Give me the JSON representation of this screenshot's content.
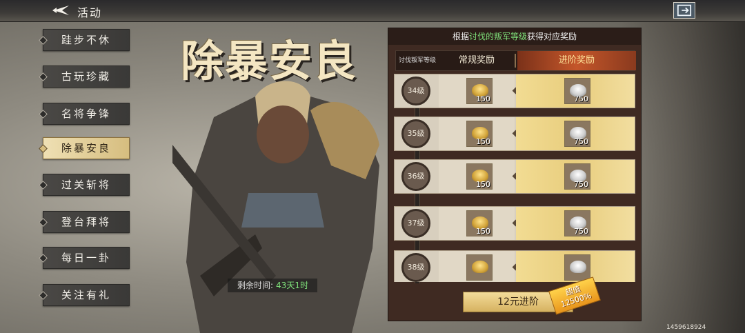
{
  "header": {
    "title": "活动"
  },
  "sidebar": {
    "items": [
      {
        "label": "跬步不休",
        "active": false
      },
      {
        "label": "古玩珍藏",
        "active": false
      },
      {
        "label": "名将争锋",
        "active": false
      },
      {
        "label": "除暴安良",
        "active": true
      },
      {
        "label": "过关斩将",
        "active": false
      },
      {
        "label": "登台拜将",
        "active": false
      },
      {
        "label": "每日一卦",
        "active": false
      },
      {
        "label": "关注有礼",
        "active": false
      }
    ]
  },
  "event": {
    "title": "除暴安良",
    "timer_label": "剩余时间:",
    "timer_value": "43天1时"
  },
  "rewards": {
    "header_pre": "根据",
    "header_highlight": "讨伐的叛军等级",
    "header_post": "获得对应奖励",
    "col_level": "讨伐叛军等级",
    "col_normal": "常规奖励",
    "col_advanced": "进阶奖励",
    "rows": [
      {
        "level": "34级",
        "normal_amount": "150",
        "advanced_amount": "750"
      },
      {
        "level": "35级",
        "normal_amount": "150",
        "advanced_amount": "750"
      },
      {
        "level": "36级",
        "normal_amount": "150",
        "advanced_amount": "750"
      },
      {
        "level": "37级",
        "normal_amount": "150",
        "advanced_amount": "750"
      },
      {
        "level": "38级",
        "normal_amount": "",
        "advanced_amount": ""
      }
    ],
    "buy_label": "12元进阶",
    "promo_line1": "超值",
    "promo_line2": "12500%"
  },
  "footer": {
    "uid": "1459618924"
  },
  "colors": {
    "highlight": "#7fe07a",
    "gold": "#d6bd7f"
  },
  "icons": {
    "back": "back-arrow-icon",
    "exit": "exit-icon",
    "normal_reward": "gold-ingot-icon",
    "advanced_reward": "silver-ingot-icon"
  }
}
